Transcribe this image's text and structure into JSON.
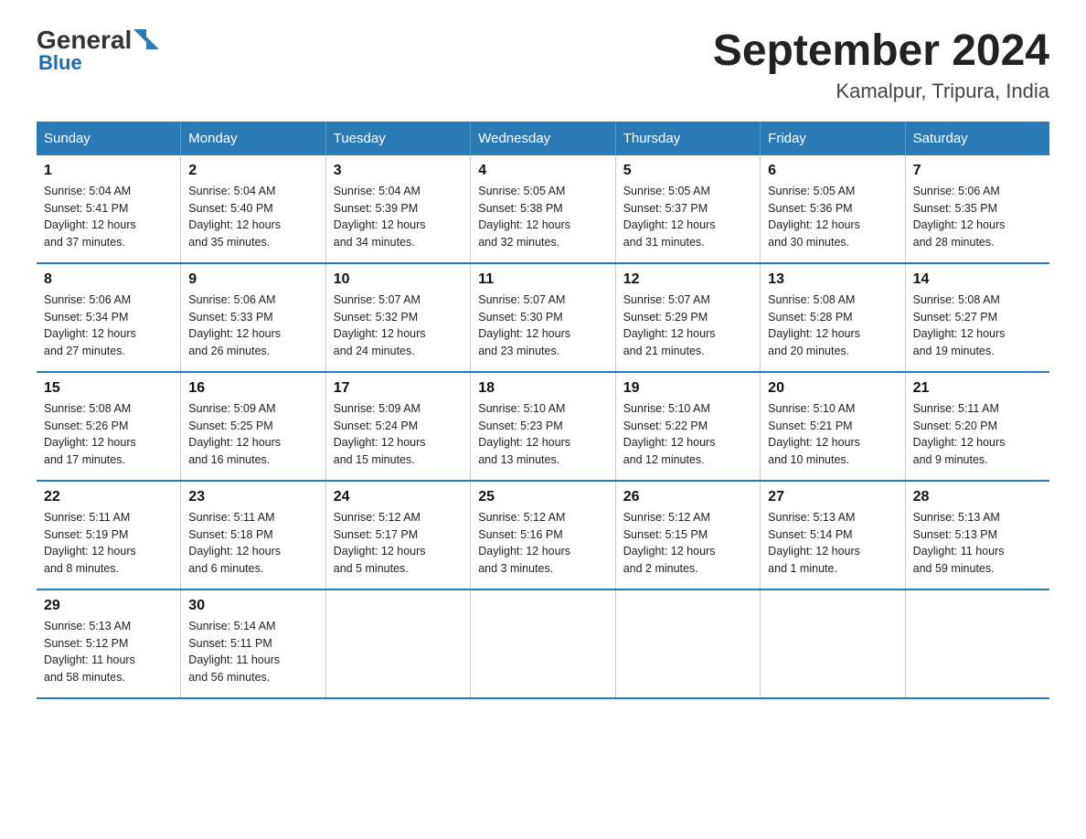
{
  "header": {
    "logo_general": "General",
    "logo_blue": "Blue",
    "title": "September 2024",
    "subtitle": "Kamalpur, Tripura, India"
  },
  "weekdays": [
    "Sunday",
    "Monday",
    "Tuesday",
    "Wednesday",
    "Thursday",
    "Friday",
    "Saturday"
  ],
  "weeks": [
    [
      {
        "day": "1",
        "sunrise": "5:04 AM",
        "sunset": "5:41 PM",
        "daylight": "12 hours and 37 minutes."
      },
      {
        "day": "2",
        "sunrise": "5:04 AM",
        "sunset": "5:40 PM",
        "daylight": "12 hours and 35 minutes."
      },
      {
        "day": "3",
        "sunrise": "5:04 AM",
        "sunset": "5:39 PM",
        "daylight": "12 hours and 34 minutes."
      },
      {
        "day": "4",
        "sunrise": "5:05 AM",
        "sunset": "5:38 PM",
        "daylight": "12 hours and 32 minutes."
      },
      {
        "day": "5",
        "sunrise": "5:05 AM",
        "sunset": "5:37 PM",
        "daylight": "12 hours and 31 minutes."
      },
      {
        "day": "6",
        "sunrise": "5:05 AM",
        "sunset": "5:36 PM",
        "daylight": "12 hours and 30 minutes."
      },
      {
        "day": "7",
        "sunrise": "5:06 AM",
        "sunset": "5:35 PM",
        "daylight": "12 hours and 28 minutes."
      }
    ],
    [
      {
        "day": "8",
        "sunrise": "5:06 AM",
        "sunset": "5:34 PM",
        "daylight": "12 hours and 27 minutes."
      },
      {
        "day": "9",
        "sunrise": "5:06 AM",
        "sunset": "5:33 PM",
        "daylight": "12 hours and 26 minutes."
      },
      {
        "day": "10",
        "sunrise": "5:07 AM",
        "sunset": "5:32 PM",
        "daylight": "12 hours and 24 minutes."
      },
      {
        "day": "11",
        "sunrise": "5:07 AM",
        "sunset": "5:30 PM",
        "daylight": "12 hours and 23 minutes."
      },
      {
        "day": "12",
        "sunrise": "5:07 AM",
        "sunset": "5:29 PM",
        "daylight": "12 hours and 21 minutes."
      },
      {
        "day": "13",
        "sunrise": "5:08 AM",
        "sunset": "5:28 PM",
        "daylight": "12 hours and 20 minutes."
      },
      {
        "day": "14",
        "sunrise": "5:08 AM",
        "sunset": "5:27 PM",
        "daylight": "12 hours and 19 minutes."
      }
    ],
    [
      {
        "day": "15",
        "sunrise": "5:08 AM",
        "sunset": "5:26 PM",
        "daylight": "12 hours and 17 minutes."
      },
      {
        "day": "16",
        "sunrise": "5:09 AM",
        "sunset": "5:25 PM",
        "daylight": "12 hours and 16 minutes."
      },
      {
        "day": "17",
        "sunrise": "5:09 AM",
        "sunset": "5:24 PM",
        "daylight": "12 hours and 15 minutes."
      },
      {
        "day": "18",
        "sunrise": "5:10 AM",
        "sunset": "5:23 PM",
        "daylight": "12 hours and 13 minutes."
      },
      {
        "day": "19",
        "sunrise": "5:10 AM",
        "sunset": "5:22 PM",
        "daylight": "12 hours and 12 minutes."
      },
      {
        "day": "20",
        "sunrise": "5:10 AM",
        "sunset": "5:21 PM",
        "daylight": "12 hours and 10 minutes."
      },
      {
        "day": "21",
        "sunrise": "5:11 AM",
        "sunset": "5:20 PM",
        "daylight": "12 hours and 9 minutes."
      }
    ],
    [
      {
        "day": "22",
        "sunrise": "5:11 AM",
        "sunset": "5:19 PM",
        "daylight": "12 hours and 8 minutes."
      },
      {
        "day": "23",
        "sunrise": "5:11 AM",
        "sunset": "5:18 PM",
        "daylight": "12 hours and 6 minutes."
      },
      {
        "day": "24",
        "sunrise": "5:12 AM",
        "sunset": "5:17 PM",
        "daylight": "12 hours and 5 minutes."
      },
      {
        "day": "25",
        "sunrise": "5:12 AM",
        "sunset": "5:16 PM",
        "daylight": "12 hours and 3 minutes."
      },
      {
        "day": "26",
        "sunrise": "5:12 AM",
        "sunset": "5:15 PM",
        "daylight": "12 hours and 2 minutes."
      },
      {
        "day": "27",
        "sunrise": "5:13 AM",
        "sunset": "5:14 PM",
        "daylight": "12 hours and 1 minute."
      },
      {
        "day": "28",
        "sunrise": "5:13 AM",
        "sunset": "5:13 PM",
        "daylight": "11 hours and 59 minutes."
      }
    ],
    [
      {
        "day": "29",
        "sunrise": "5:13 AM",
        "sunset": "5:12 PM",
        "daylight": "11 hours and 58 minutes."
      },
      {
        "day": "30",
        "sunrise": "5:14 AM",
        "sunset": "5:11 PM",
        "daylight": "11 hours and 56 minutes."
      },
      null,
      null,
      null,
      null,
      null
    ]
  ],
  "labels": {
    "sunrise": "Sunrise:",
    "sunset": "Sunset:",
    "daylight": "Daylight:"
  }
}
